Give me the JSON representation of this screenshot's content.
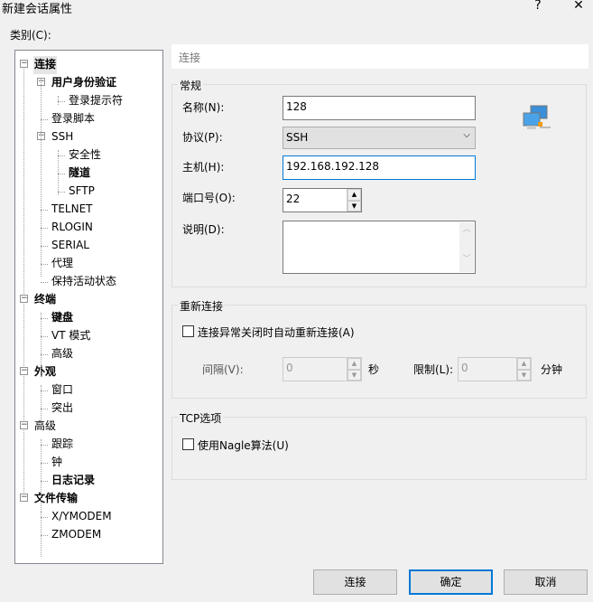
{
  "window": {
    "title": "新建会话属性",
    "help": "?",
    "close": "✕"
  },
  "category_label": "类别(C):",
  "tree": [
    {
      "label": "连接",
      "level": 0,
      "bold": true,
      "expander": "−",
      "selected": true
    },
    {
      "label": "用户身份验证",
      "level": 1,
      "bold": true,
      "expander": "−"
    },
    {
      "label": "登录提示符",
      "level": 2
    },
    {
      "label": "登录脚本",
      "level": 1
    },
    {
      "label": "SSH",
      "level": 1,
      "expander": "−"
    },
    {
      "label": "安全性",
      "level": 2
    },
    {
      "label": "隧道",
      "level": 2,
      "bold": true
    },
    {
      "label": "SFTP",
      "level": 2
    },
    {
      "label": "TELNET",
      "level": 1
    },
    {
      "label": "RLOGIN",
      "level": 1
    },
    {
      "label": "SERIAL",
      "level": 1
    },
    {
      "label": "代理",
      "level": 1
    },
    {
      "label": "保持活动状态",
      "level": 1
    },
    {
      "label": "终端",
      "level": 0,
      "bold": true,
      "expander": "−"
    },
    {
      "label": "键盘",
      "level": 1,
      "bold": true
    },
    {
      "label": "VT 模式",
      "level": 1
    },
    {
      "label": "高级",
      "level": 1
    },
    {
      "label": "外观",
      "level": 0,
      "bold": true,
      "expander": "−"
    },
    {
      "label": "窗口",
      "level": 1
    },
    {
      "label": "突出",
      "level": 1
    },
    {
      "label": "高级",
      "level": 0,
      "expander": "−"
    },
    {
      "label": "跟踪",
      "level": 1
    },
    {
      "label": "钟",
      "level": 1
    },
    {
      "label": "日志记录",
      "level": 1,
      "bold": true
    },
    {
      "label": "文件传输",
      "level": 0,
      "bold": true,
      "expander": "−"
    },
    {
      "label": "X/YMODEM",
      "level": 1
    },
    {
      "label": "ZMODEM",
      "level": 1
    }
  ],
  "panel_header": "连接",
  "general": {
    "title": "常规",
    "name_label": "名称(N):",
    "name_value": "128",
    "protocol_label": "协议(P):",
    "protocol_value": "SSH",
    "host_label": "主机(H):",
    "host_value": "192.168.192.128",
    "port_label": "端口号(O):",
    "port_value": "22",
    "desc_label": "说明(D):",
    "desc_value": ""
  },
  "reconnect": {
    "title": "重新连接",
    "checkbox_label": "连接异常关闭时自动重新连接(A)",
    "checked": false,
    "interval_label": "间隔(V):",
    "interval_value": "0",
    "interval_unit": "秒",
    "limit_label": "限制(L):",
    "limit_value": "0",
    "limit_unit": "分钟"
  },
  "tcp": {
    "title": "TCP选项",
    "nagle_label": "使用Nagle算法(U)",
    "checked": false
  },
  "buttons": {
    "connect": "连接",
    "ok": "确定",
    "cancel": "取消"
  }
}
